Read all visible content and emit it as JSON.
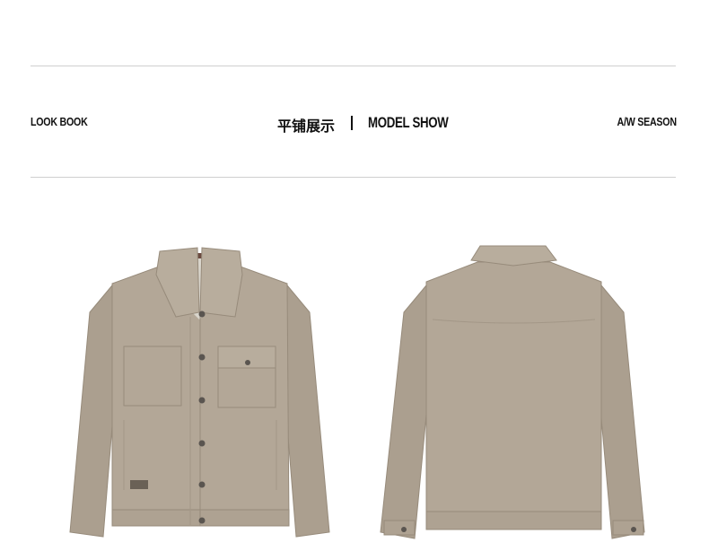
{
  "header": {
    "left_label": "LOOK BOOK",
    "center_cn": "平铺展示",
    "center_en": "MODEL SHOW",
    "right_label": "A/W SEASON"
  },
  "colors": {
    "jacket": "#b3a797",
    "jacket_shadow": "#9d9181",
    "lining": "#d9d5cc",
    "rule": "#cfcfcf",
    "text": "#111111"
  },
  "images": {
    "front": "jacket-front-flat-lay",
    "back": "jacket-back-flat-lay"
  }
}
